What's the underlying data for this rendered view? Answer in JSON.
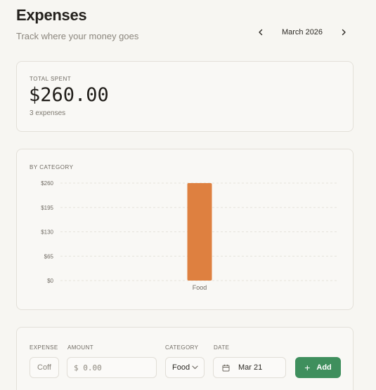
{
  "header": {
    "title": "Expenses",
    "subtitle": "Track where your money goes"
  },
  "month_nav": {
    "prev_icon": "chevron-left-icon",
    "label": "March 2026",
    "next_icon": "chevron-right-icon"
  },
  "summary": {
    "label": "TOTAL SPENT",
    "amount": "$260.00",
    "count": "3 expenses"
  },
  "chart_card": {
    "label": "BY CATEGORY"
  },
  "chart_data": {
    "type": "bar",
    "categories": [
      "Food"
    ],
    "values": [
      260
    ],
    "ylim": [
      0,
      260
    ],
    "yticks": [
      "$260",
      "$195",
      "$130",
      "$65",
      "$0"
    ],
    "ytick_values": [
      260,
      195,
      130,
      65,
      0
    ],
    "grid": true,
    "bar_color": "#de8040"
  },
  "form": {
    "expense_label": "EXPENSE",
    "expense_value": "Coff",
    "amount_label": "AMOUNT",
    "amount_placeholder": "$ 0.00",
    "category_label": "CATEGORY",
    "category_value": "Food",
    "date_label": "DATE",
    "date_value": "Mar 21",
    "add_label": "Add"
  },
  "colors": {
    "background": "#f7f6f2",
    "accent_green": "#3f8f5d",
    "bar_orange": "#de8040"
  }
}
